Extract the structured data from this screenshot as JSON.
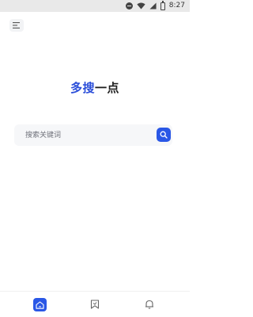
{
  "status_bar": {
    "time": "8:27",
    "icons": [
      "do-not-disturb-icon",
      "wifi-icon",
      "signal-icon",
      "battery-icon"
    ]
  },
  "header": {
    "menu_icon": "menu-icon"
  },
  "brand": {
    "accent_text": "多搜",
    "rest_text": "一点",
    "accent_color": "#2c4fd9",
    "text_color": "#1f1f1f"
  },
  "search": {
    "placeholder": "搜索关键词",
    "value": "",
    "button_icon": "search-icon",
    "button_color": "#2a57e6"
  },
  "bottom_nav": {
    "items": [
      {
        "icon": "home-icon",
        "active": true
      },
      {
        "icon": "bookmark-icon",
        "active": false
      },
      {
        "icon": "bell-icon",
        "active": false
      }
    ]
  }
}
